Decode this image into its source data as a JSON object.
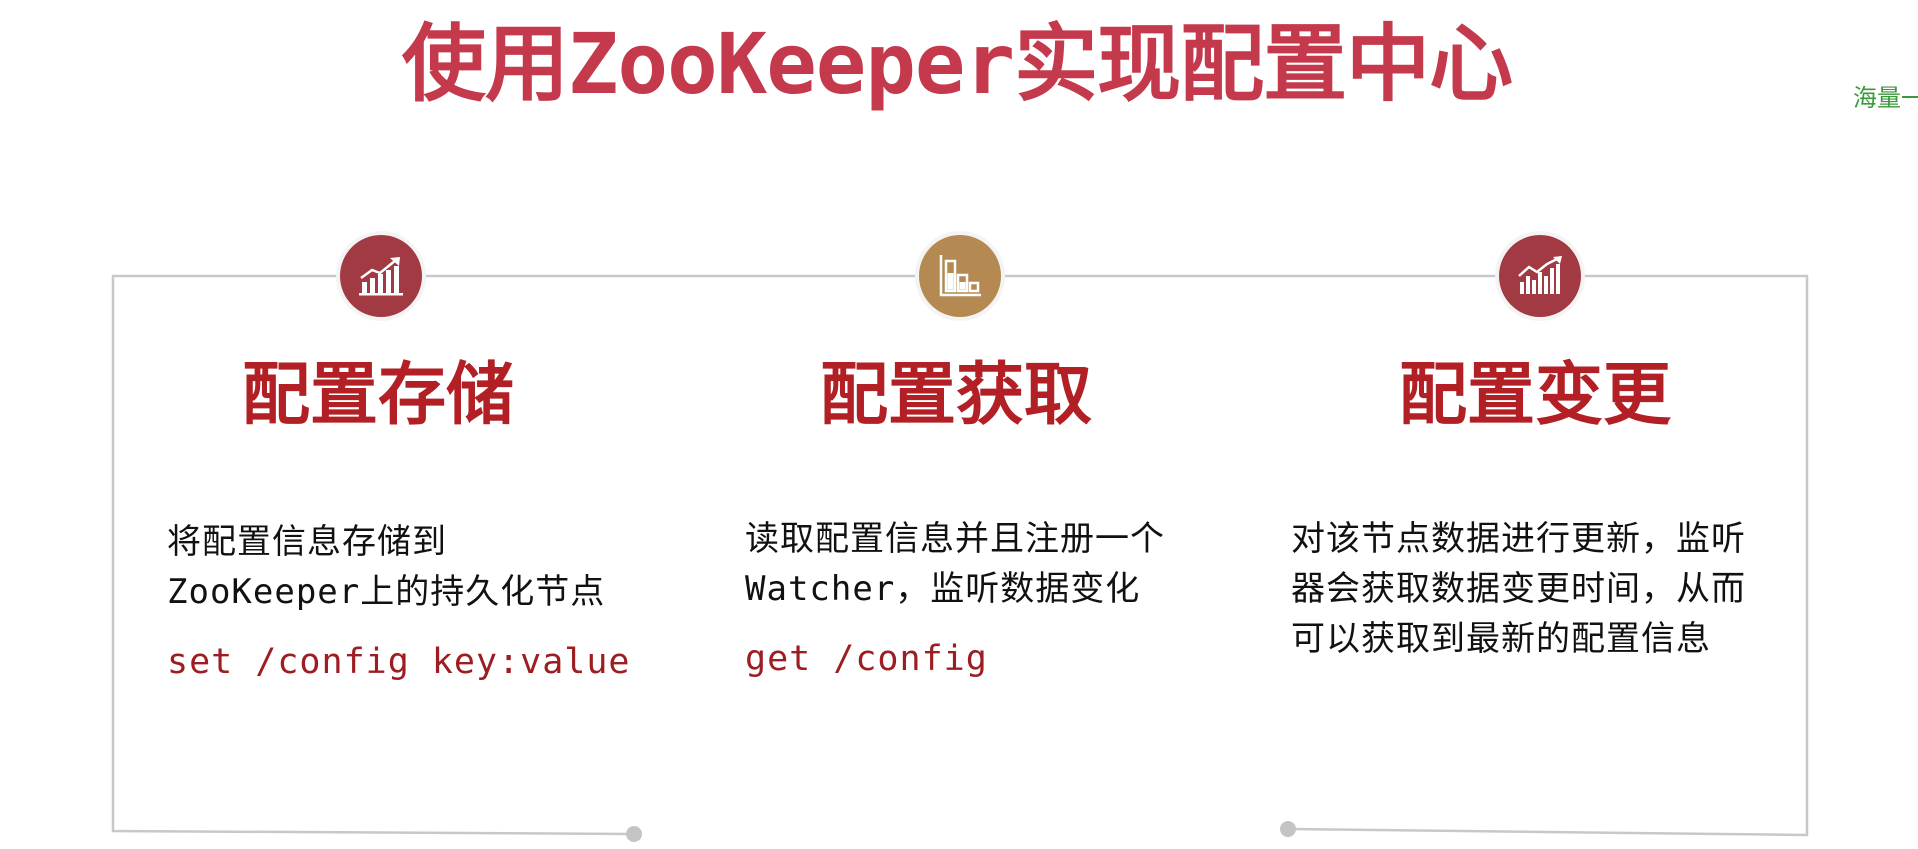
{
  "page": {
    "title": "使用ZooKeeper实现配置中心",
    "watermark": "海量一"
  },
  "columns": [
    {
      "icon": "trending-up-chart-icon",
      "icon_color": "#a23a43",
      "title": "配置存储",
      "description_lines": [
        "将配置信息存储到",
        "ZooKeeper上的持久化节点"
      ],
      "command": "set /config key:value"
    },
    {
      "icon": "bar-chart-icon",
      "icon_color": "#b48a52",
      "title": "配置获取",
      "description_lines": [
        "读取配置信息并且注册一个",
        "Watcher，监听数据变化"
      ],
      "command": "get /config"
    },
    {
      "icon": "growth-chart-icon",
      "icon_color": "#a23a43",
      "title": "配置变更",
      "description_lines": [
        "对该节点数据进行更新，监听",
        "器会获取数据变更时间，从而",
        "可以获取到最新的配置信息"
      ],
      "command": ""
    }
  ],
  "colors": {
    "title": "#c43a4c",
    "column_title": "#b21f24",
    "command": "#9c1e22",
    "frame_line": "#c8c8c8"
  }
}
